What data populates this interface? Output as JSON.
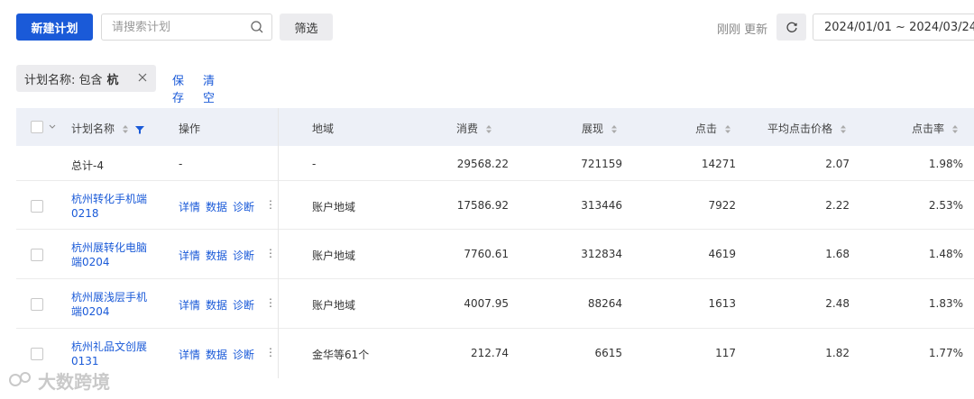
{
  "toolbar": {
    "new_plan_label": "新建计划",
    "search_placeholder": "请搜索计划",
    "filter_label": "筛选",
    "updated_text": "刚刚 更新",
    "date_range": "2024/01/01 ~ 2024/03/24"
  },
  "filter_tags": {
    "tag_prefix": "计划名称: 包含",
    "tag_value": "杭",
    "save_label": "保存",
    "clear_label": "清空"
  },
  "table": {
    "headers": {
      "name": "计划名称",
      "ops": "操作",
      "region": "地域",
      "spend": "消费",
      "impressions": "展现",
      "clicks": "点击",
      "avg_cpc": "平均点击价格",
      "ctr": "点击率"
    },
    "total": {
      "name": "总计-4",
      "ops": "-",
      "region": "-",
      "spend": "29568.22",
      "impressions": "721159",
      "clicks": "14271",
      "avg_cpc": "2.07",
      "ctr": "1.98%"
    },
    "ops_labels": {
      "detail": "详情",
      "data": "数据",
      "diagnose": "诊断"
    },
    "rows": [
      {
        "name": "杭州转化手机端0218",
        "region": "账户地域",
        "spend": "17586.92",
        "impressions": "313446",
        "clicks": "7922",
        "avg_cpc": "2.22",
        "ctr": "2.53%"
      },
      {
        "name": "杭州展转化电脑端0204",
        "region": "账户地域",
        "spend": "7760.61",
        "impressions": "312834",
        "clicks": "4619",
        "avg_cpc": "1.68",
        "ctr": "1.48%"
      },
      {
        "name": "杭州展浅层手机端0204",
        "region": "账户地域",
        "spend": "4007.95",
        "impressions": "88264",
        "clicks": "1613",
        "avg_cpc": "2.48",
        "ctr": "1.83%"
      },
      {
        "name": "杭州礼品文创展0131",
        "region": "金华等61个",
        "spend": "212.74",
        "impressions": "6615",
        "clicks": "117",
        "avg_cpc": "1.82",
        "ctr": "1.77%"
      }
    ]
  },
  "watermark": "大数跨境",
  "colors": {
    "primary": "#1a5ad8",
    "header_bg": "#edf0f7",
    "button_gray": "#ececef"
  }
}
